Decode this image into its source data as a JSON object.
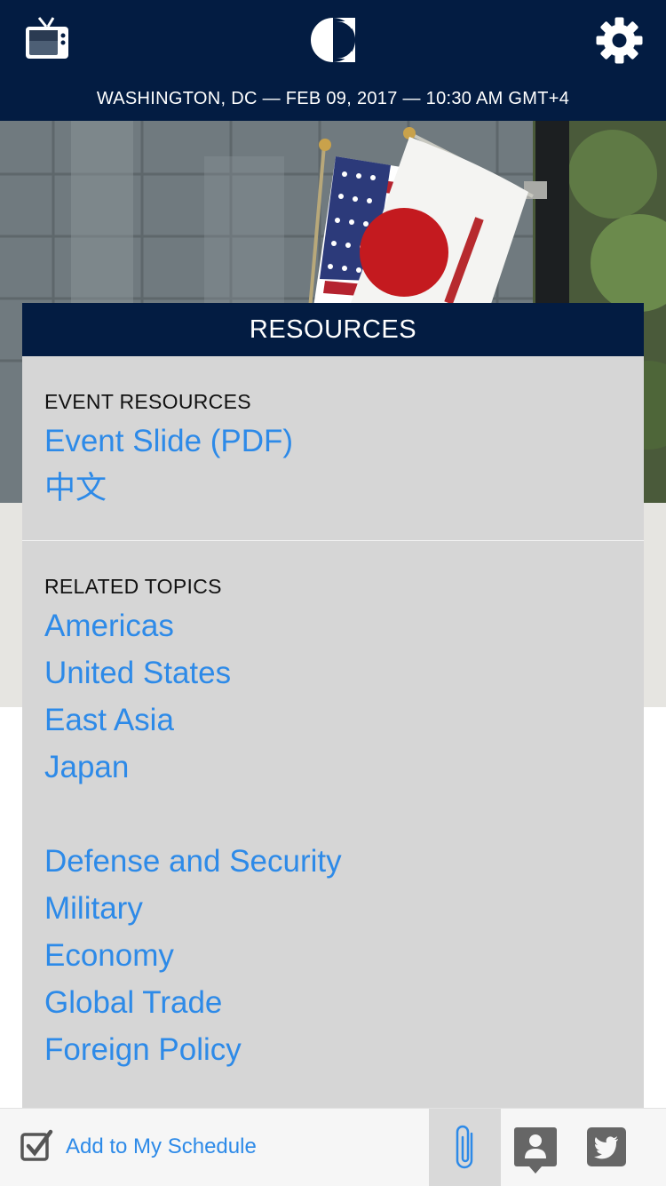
{
  "header": {
    "tv_icon": "tv-icon",
    "logo_icon": "logo-icon",
    "settings_icon": "gear-icon",
    "dateline": "WASHINGTON, DC — FEB 09, 2017 — 10:30 AM GMT+4"
  },
  "hero": {
    "image": "us-japan-flags-photo"
  },
  "resources": {
    "title": "RESOURCES",
    "event_resources_label": "EVENT RESOURCES",
    "event_links": [
      "Event Slide (PDF)",
      "中文"
    ],
    "related_topics_label": "RELATED TOPICS",
    "topics_group1": [
      "Americas",
      "United States",
      "East Asia",
      "Japan"
    ],
    "topics_group2": [
      "Defense and Security",
      "Military",
      "Economy",
      "Global Trade",
      "Foreign Policy"
    ]
  },
  "footer": {
    "add_schedule_label": "Add to My Schedule",
    "checkbox_icon": "checkbox-checked-icon",
    "paperclip_icon": "paperclip-icon",
    "speaker_icon": "person-icon",
    "twitter_icon": "twitter-icon"
  },
  "colors": {
    "navy": "#031c42",
    "link_blue": "#2d8ae8",
    "panel_gray": "#d6d6d6"
  }
}
